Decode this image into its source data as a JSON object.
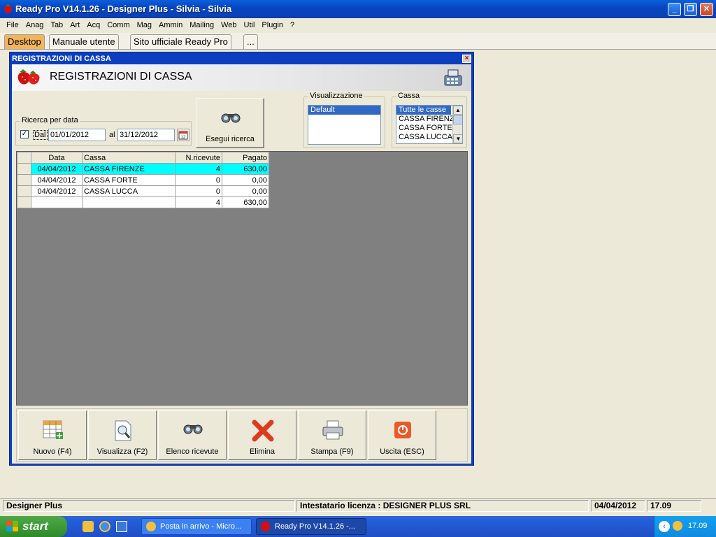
{
  "app": {
    "title": "Ready Pro V14.1.26 - Designer Plus - Silvia - Silvia"
  },
  "menu": [
    "File",
    "Anag",
    "Tab",
    "Art",
    "Acq",
    "Comm",
    "Mag",
    "Ammin",
    "Mailing",
    "Web",
    "Util",
    "Plugin",
    "?"
  ],
  "tabs": [
    {
      "label": "Desktop",
      "active": true
    },
    {
      "label": "Manuale utente"
    },
    {
      "label": "Sito ufficiale Ready Pro"
    },
    {
      "label": "..."
    }
  ],
  "window": {
    "title": "REGISTRAZIONI DI CASSA",
    "banner_title": "REGISTRAZIONI DI CASSA"
  },
  "search": {
    "group_label": "Ricerca per data",
    "checkbox_label": "Dal",
    "checked": true,
    "from_date": "01/01/2012",
    "to_label": "al",
    "to_date": "31/12/2012",
    "button_label": "Esegui ricerca"
  },
  "view": {
    "group_label": "Visualizzazione",
    "items": [
      "Default"
    ]
  },
  "cassa": {
    "group_label": "Cassa",
    "items": [
      "Tutte le casse",
      "CASSA FIRENZE",
      "CASSA FORTE",
      "CASSA LUCCA"
    ]
  },
  "grid": {
    "columns": [
      "Data",
      "Cassa",
      "N.ricevute",
      "Pagato"
    ],
    "rows": [
      {
        "data": "04/04/2012",
        "cassa": "CASSA FIRENZE",
        "ricevute": "4",
        "pagato": "630,00"
      },
      {
        "data": "04/04/2012",
        "cassa": "CASSA FORTE",
        "ricevute": "0",
        "pagato": "0,00"
      },
      {
        "data": "04/04/2012",
        "cassa": "CASSA LUCCA",
        "ricevute": "0",
        "pagato": "0,00"
      }
    ],
    "totals": {
      "ricevute": "4",
      "pagato": "630,00"
    }
  },
  "toolbar": {
    "nuovo": "Nuovo (F4)",
    "visualizza": "Visualizza (F2)",
    "elenco": "Elenco ricevute",
    "elimina": "Elimina",
    "stampa": "Stampa (F9)",
    "uscita": "Uscita (ESC)"
  },
  "status": {
    "left": "Designer Plus",
    "license": "Intestatario licenza : DESIGNER PLUS SRL",
    "date": "04/04/2012",
    "time": "17.09"
  },
  "taskbar": {
    "start": "start",
    "task1": "Posta in arrivo - Micro...",
    "task2": "Ready Pro V14.1.26 -...",
    "clock": "17.09"
  },
  "colors": {
    "selected_row": "#00ffff",
    "titlebar": "#0a5fd8",
    "active_tab": "#f4b45a"
  }
}
